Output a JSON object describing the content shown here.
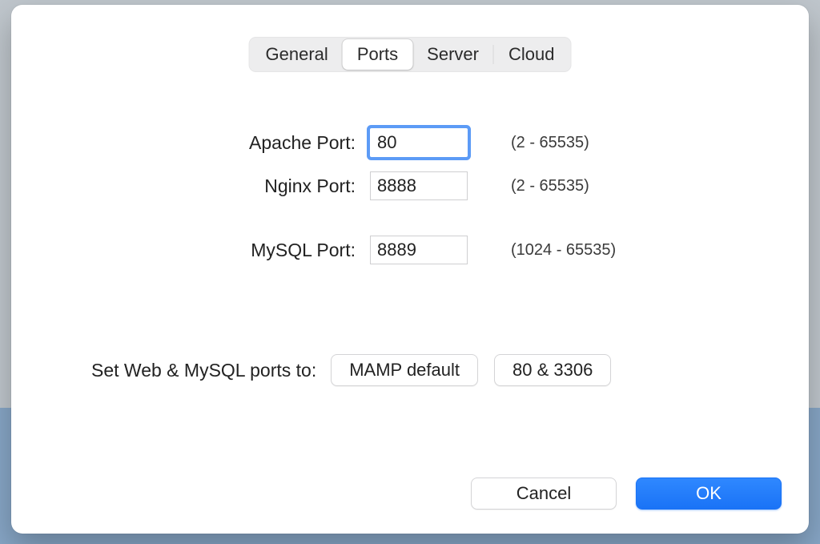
{
  "tabs": {
    "general": "General",
    "ports": "Ports",
    "server": "Server",
    "cloud": "Cloud",
    "active": "ports"
  },
  "ports": {
    "apache": {
      "label": "Apache Port:",
      "value": "80",
      "hint": "(2 - 65535)"
    },
    "nginx": {
      "label": "Nginx Port:",
      "value": "8888",
      "hint": "(2 - 65535)"
    },
    "mysql": {
      "label": "MySQL Port:",
      "value": "8889",
      "hint": "(1024 - 65535)"
    }
  },
  "presets": {
    "label": "Set Web & MySQL ports to:",
    "mamp_default": "MAMP default",
    "standard": "80 & 3306"
  },
  "actions": {
    "cancel": "Cancel",
    "ok": "OK"
  }
}
